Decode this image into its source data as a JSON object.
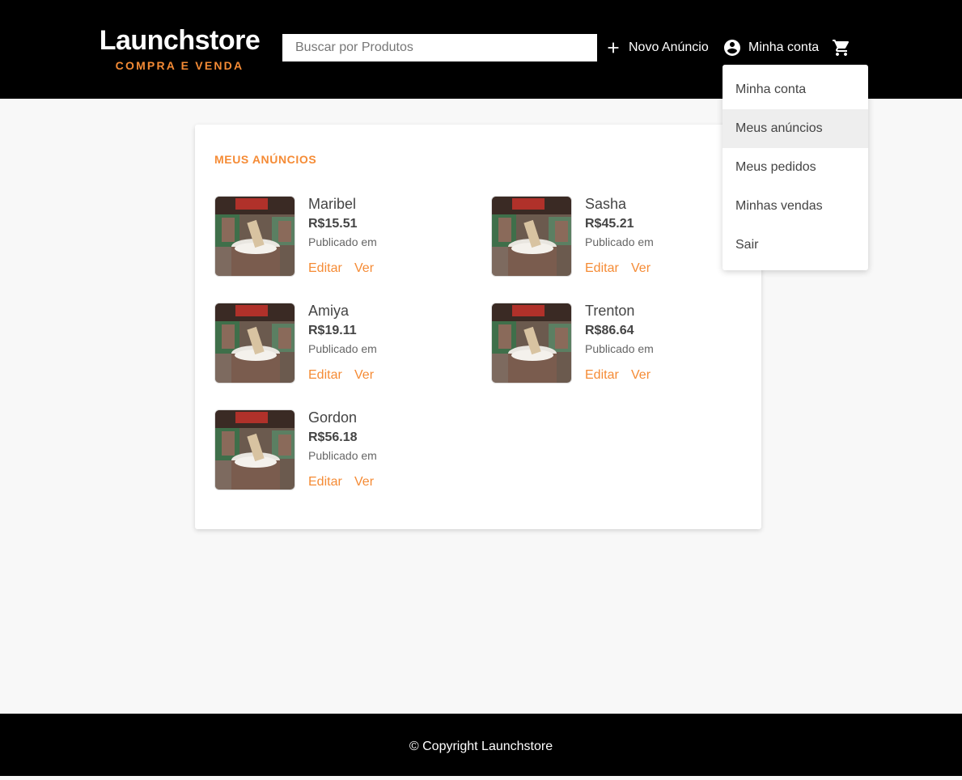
{
  "header": {
    "logo_title": "Launchstore",
    "logo_subtitle": "COMPRA E VENDA",
    "search_placeholder": "Buscar por Produtos",
    "new_ad_label": "Novo Anúncio",
    "account_label": "Minha conta",
    "icons": {
      "new_ad": "plus-icon",
      "account": "account-circle-icon",
      "cart": "shopping-cart-icon"
    }
  },
  "dropdown": {
    "items": [
      {
        "label": "Minha conta",
        "active": false
      },
      {
        "label": "Meus anúncios",
        "active": true
      },
      {
        "label": "Meus pedidos",
        "active": false
      },
      {
        "label": "Minhas vendas",
        "active": false
      },
      {
        "label": "Sair",
        "active": false
      }
    ]
  },
  "main": {
    "section_title": "MEUS ANÚNCIOS",
    "products": [
      {
        "name": "Maribel",
        "price": "R$15.51",
        "published": "Publicado em",
        "edit_label": "Editar",
        "view_label": "Ver"
      },
      {
        "name": "Sasha",
        "price": "R$45.21",
        "published": "Publicado em",
        "edit_label": "Editar",
        "view_label": "Ver"
      },
      {
        "name": "Amiya",
        "price": "R$19.11",
        "published": "Publicado em",
        "edit_label": "Editar",
        "view_label": "Ver"
      },
      {
        "name": "Trenton",
        "price": "R$86.64",
        "published": "Publicado em",
        "edit_label": "Editar",
        "view_label": "Ver"
      },
      {
        "name": "Gordon",
        "price": "R$56.18",
        "published": "Publicado em",
        "edit_label": "Editar",
        "view_label": "Ver"
      }
    ]
  },
  "footer": {
    "copyright": "© Copyright Launchstore"
  },
  "colors": {
    "accent": "#f58b35",
    "header_bg": "#000000",
    "page_bg": "#f8f8f8"
  }
}
